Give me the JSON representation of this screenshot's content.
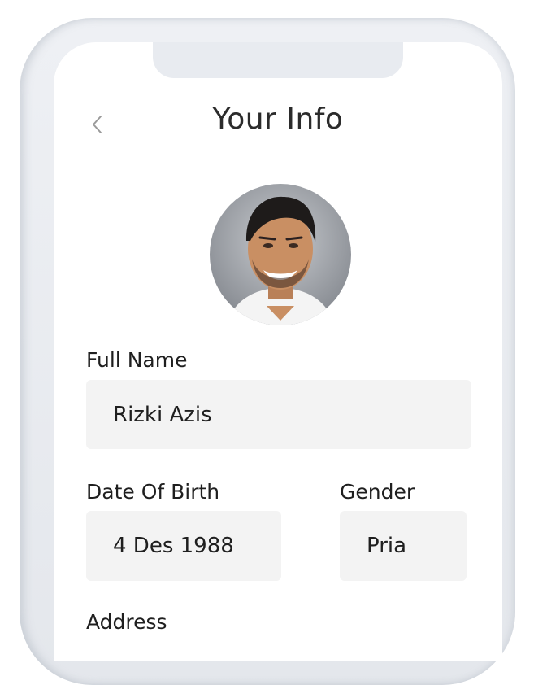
{
  "header": {
    "title": "Your Info",
    "back_icon": "chevron-left-icon"
  },
  "profile": {
    "avatar_icon": "user-avatar-photo"
  },
  "form": {
    "full_name": {
      "label": "Full Name",
      "value": "Rizki Azis"
    },
    "date_of_birth": {
      "label": "Date Of Birth",
      "value": "4 Des 1988"
    },
    "gender": {
      "label": "Gender",
      "value": "Pria"
    },
    "address": {
      "label": "Address"
    }
  },
  "colors": {
    "field_bg": "#f3f3f3",
    "text": "#1f1f1f",
    "frame": "#e8ebf0"
  }
}
